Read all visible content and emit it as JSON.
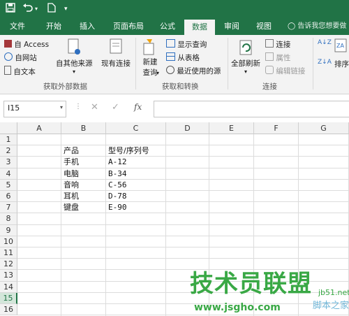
{
  "ribbon_tabs": [
    "文件",
    "开始",
    "插入",
    "页面布局",
    "公式",
    "数据",
    "审阅",
    "视图"
  ],
  "active_tab": "数据",
  "tell_me": "告诉我您想要做",
  "groups": {
    "external": {
      "label": "获取外部数据",
      "from_access": "自 Access",
      "from_web": "自网站",
      "from_text": "自文本",
      "from_other": "自其他来源",
      "existing": "现有连接"
    },
    "transform": {
      "label": "获取和转换",
      "new_query_1": "新建",
      "new_query_2": "查询",
      "show_queries": "显示查询",
      "from_table": "从表格",
      "recent_sources": "最近使用的源"
    },
    "connections": {
      "label": "连接",
      "refresh_all": "全部刷新",
      "connections": "连接",
      "properties": "属性",
      "edit_links": "编辑链接"
    },
    "sort": {
      "sort_label": "排序",
      "az": "A↓Z",
      "za": "Z↓A"
    }
  },
  "formula_bar": {
    "name_box": "I15",
    "fx": "fx",
    "formula": ""
  },
  "columns": [
    "A",
    "B",
    "C",
    "D",
    "E",
    "F",
    "G"
  ],
  "rows": [
    "1",
    "2",
    "3",
    "4",
    "5",
    "6",
    "7",
    "8",
    "9",
    "10",
    "11",
    "12",
    "13",
    "14",
    "15",
    "16"
  ],
  "selected_row": "15",
  "cells": [
    {
      "ref": "B2",
      "value": "产品"
    },
    {
      "ref": "C2",
      "value": "型号/序列号"
    },
    {
      "ref": "B3",
      "value": "手机"
    },
    {
      "ref": "C3",
      "value": "A-12"
    },
    {
      "ref": "B4",
      "value": "电脑"
    },
    {
      "ref": "C4",
      "value": "B-34"
    },
    {
      "ref": "B5",
      "value": "音响"
    },
    {
      "ref": "C5",
      "value": "C-56"
    },
    {
      "ref": "B6",
      "value": "耳机"
    },
    {
      "ref": "C6",
      "value": "D-78"
    },
    {
      "ref": "B7",
      "value": "键盘"
    },
    {
      "ref": "C7",
      "value": "E-90"
    }
  ],
  "watermark": {
    "main": "技术员联盟",
    "site": "www.jsgho.com",
    "side": "jb51.net",
    "side2": "脚本之家"
  },
  "colors": {
    "excel_green": "#217346",
    "watermark_green": "#39a845"
  }
}
